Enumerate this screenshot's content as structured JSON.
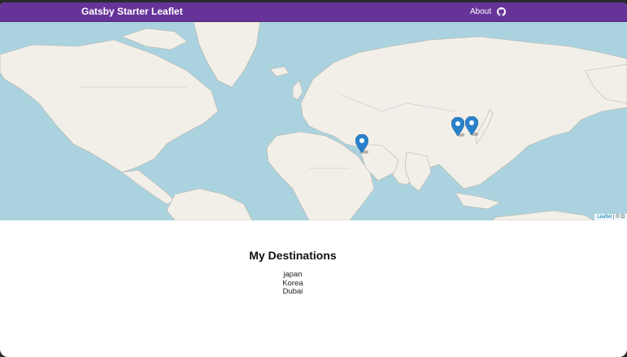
{
  "navbar": {
    "brand": "Gatsby Starter Leaflet",
    "links": [
      {
        "label": "About"
      }
    ],
    "github_icon": "github-icon",
    "background": "#663399"
  },
  "map": {
    "tile_style": "OpenStreetMap",
    "water_color": "#aad3df",
    "land_color": "#f2efe9",
    "marker_color": "#2a81cb",
    "markers": [
      {
        "label": "japan",
        "icon": "map-marker-icon"
      },
      {
        "label": "Korea",
        "icon": "map-marker-icon"
      },
      {
        "label": "Dubai",
        "icon": "map-marker-icon"
      }
    ],
    "attribution": {
      "leaflet_link": "Leaflet",
      "separator": " | © O"
    }
  },
  "destinations": {
    "title": "My Destinations",
    "items": [
      "japan",
      "Korea",
      "Dubai"
    ]
  }
}
